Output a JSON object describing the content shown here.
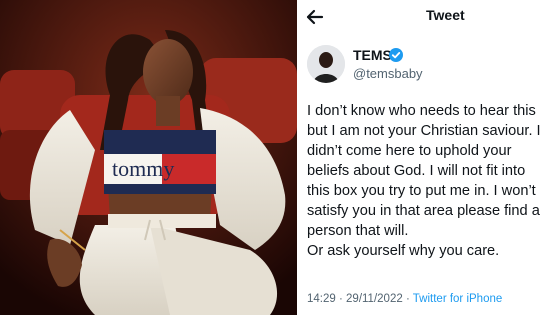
{
  "photo": {
    "shirt_text": "tommy",
    "colors": {
      "backdrop": "#5a1a10",
      "seat": "#a3281c",
      "jacket": "#ece7dc",
      "top_red": "#c92a2a",
      "top_navy": "#1f2b52"
    }
  },
  "tweet_view": {
    "header": {
      "title": "Tweet",
      "back_icon": "arrow-left-icon"
    },
    "author": {
      "name": "TEMS",
      "handle": "@temsbaby",
      "verified": true,
      "verified_color": "#1d9bf0"
    },
    "text_lines": [
      "I don’t know who needs to hear this",
      "but I am not your Christian saviour. I",
      "didn’t come here to uphold your",
      "beliefs about God. I will not fit into",
      "this box you try to put me in. I won’t",
      "satisfy you in that area please find a",
      "person that will.",
      "Or ask yourself why you care."
    ],
    "meta": {
      "time": "14:29",
      "separator": "·",
      "date": "29/11/2022",
      "source": "Twitter for iPhone"
    }
  }
}
